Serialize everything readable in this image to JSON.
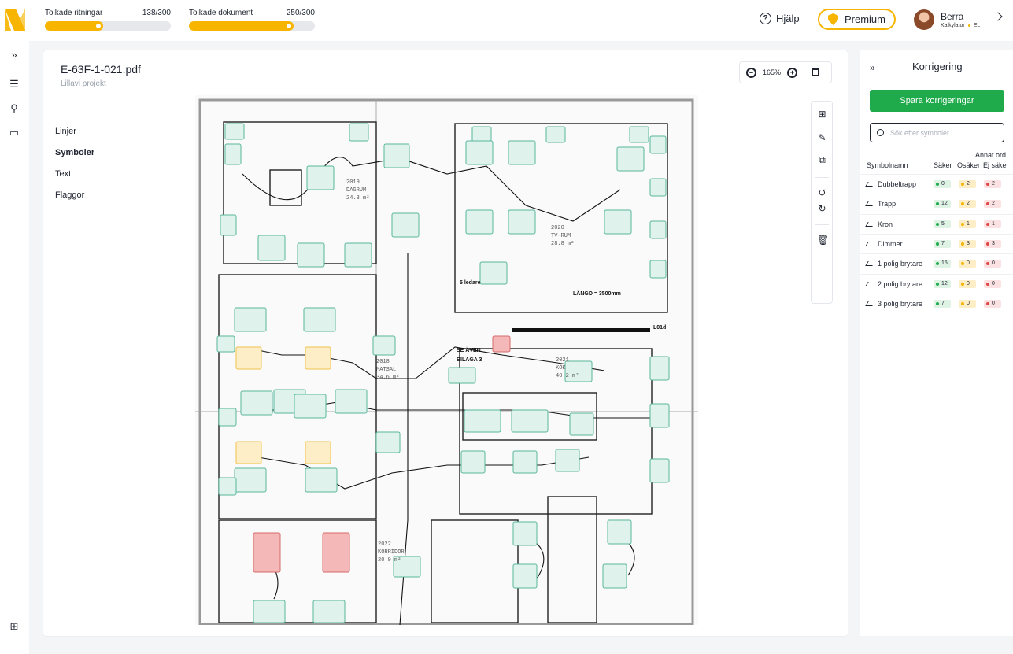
{
  "header": {
    "progress": [
      {
        "label": "Tolkade ritningar",
        "count": "138/300",
        "fraction": 0.46
      },
      {
        "label": "Tolkade dokument",
        "count": "250/300",
        "fraction": 0.833
      }
    ],
    "help_label": "Hjälp",
    "premium_label": "Premium",
    "user": {
      "name": "Berra",
      "role": "Kalkylator",
      "role_tag": "EL"
    }
  },
  "rail": {
    "icons": [
      "expand-icon",
      "list-icon",
      "search-icon",
      "folder-icon",
      "add-folder-icon"
    ]
  },
  "document": {
    "file_name": "E-63F-1-021.pdf",
    "project": "Lillavi projekt",
    "zoom": "165%",
    "tabs": [
      {
        "label": "Linjer"
      },
      {
        "label": "Symboler",
        "active": true
      },
      {
        "label": "Text"
      },
      {
        "label": "Flaggor"
      }
    ]
  },
  "plan": {
    "rooms": [
      {
        "num": "2019",
        "name": "DAGRUM",
        "area": "24.3 m²"
      },
      {
        "num": "2020",
        "name": "TV-RUM",
        "area": "28.8 m²"
      },
      {
        "num": "2018",
        "name": "MATSAL",
        "area": "34.6 m²"
      },
      {
        "num": "2021",
        "name": "KÖK",
        "area": "40.2 m²"
      },
      {
        "num": "2022",
        "name": "KORRIDOR",
        "area": "20.9 m²"
      }
    ],
    "notes": [
      "5 ledare",
      "LÄNGD = 3500mm",
      "L01d",
      "SE ÄVEN",
      "BILAGA 3"
    ]
  },
  "panel": {
    "title": "Korrigering",
    "save_label": "Spara korrigeringar",
    "search_placeholder": "Sök efter symboler...",
    "annat": "Annat ord..",
    "headers": {
      "name": "Symbolnamn",
      "sure": "Säker",
      "unsure": "Osäker",
      "not_sure": "Ej säker"
    },
    "rows": [
      {
        "name": "Dubbeltrapp",
        "sure": "0",
        "unsure": "2",
        "not_sure": "2"
      },
      {
        "name": "Trapp",
        "sure": "12",
        "unsure": "2",
        "not_sure": "2"
      },
      {
        "name": "Kron",
        "sure": "5",
        "unsure": "1",
        "not_sure": "1"
      },
      {
        "name": "Dimmer",
        "sure": "7",
        "unsure": "3",
        "not_sure": "3"
      },
      {
        "name": "1 polig brytare",
        "sure": "15",
        "unsure": "0",
        "not_sure": "0"
      },
      {
        "name": "2 polig brytare",
        "sure": "12",
        "unsure": "0",
        "not_sure": "0"
      },
      {
        "name": "3 polig brytare",
        "sure": "7",
        "unsure": "0",
        "not_sure": "0"
      }
    ]
  },
  "colors": {
    "accent": "#f7b500",
    "save": "#1faa4b",
    "sure": "#1faa4b",
    "unsure": "#f7b500",
    "not_sure": "#e04545"
  }
}
